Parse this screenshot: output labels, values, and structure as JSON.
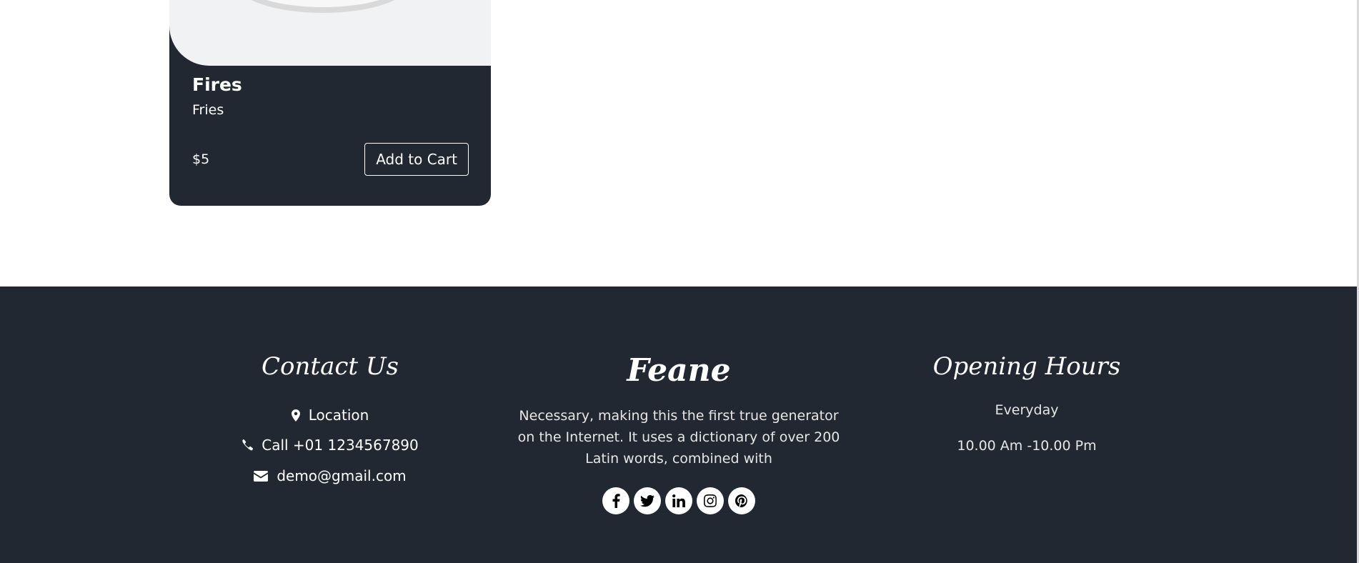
{
  "product_card": {
    "title": "Fires",
    "description": "Fries",
    "price": "$5",
    "add_to_cart_label": "Add to Cart"
  },
  "footer": {
    "contact": {
      "heading": "Contact Us",
      "items": [
        {
          "icon": "map-marker-icon",
          "text": "Location"
        },
        {
          "icon": "phone-icon",
          "text": "Call +01 1234567890"
        },
        {
          "icon": "envelope-icon",
          "text": "demo@gmail.com"
        }
      ]
    },
    "brand": {
      "name": "Feane",
      "description": "Necessary, making this the first true generator on the Internet. It uses a dictionary of over 200 Latin words, combined with",
      "social_icons": [
        "facebook-icon",
        "twitter-icon",
        "linkedin-icon",
        "instagram-icon",
        "pinterest-icon"
      ]
    },
    "hours": {
      "heading": "Opening Hours",
      "days": "Everyday",
      "time": "10.00 Am -10.00 Pm"
    }
  },
  "colors": {
    "dark": "#222831",
    "image_bg": "#f1f2f3",
    "text": "#ffffff"
  }
}
